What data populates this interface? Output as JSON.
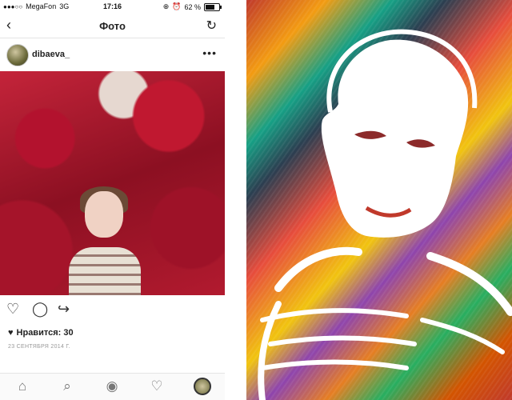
{
  "statusbar": {
    "carrier": "MegaFon",
    "network": "3G",
    "time": "17:16",
    "battery_percent": "62 %"
  },
  "navbar": {
    "title": "Фото"
  },
  "post": {
    "username": "dibaeva_",
    "likes_label": "Нравится: 30",
    "date": "23 СЕНТЯБРЯ 2014 Г."
  },
  "icons": {
    "back": "chevron-left-icon",
    "refresh": "refresh-icon",
    "more": "more-options-icon",
    "like": "heart-icon",
    "comment": "comment-icon",
    "share": "share-icon",
    "tab_home": "home-icon",
    "tab_search": "search-icon",
    "tab_camera": "camera-icon",
    "tab_activity": "heart-icon",
    "tab_profile": "profile-avatar-icon"
  },
  "colors": {
    "accent": "#222222",
    "muted": "#999999"
  }
}
